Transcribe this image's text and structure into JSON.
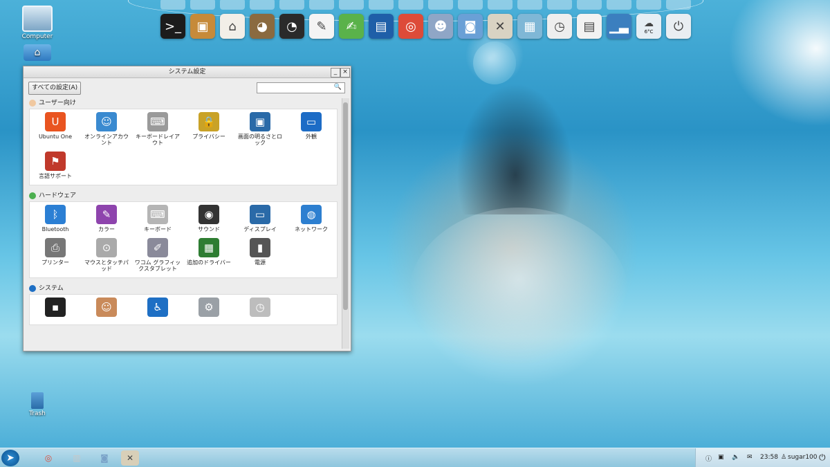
{
  "desktop": {
    "computer_label": "Computer",
    "trash_label": "Trash"
  },
  "window": {
    "title": "システム設定",
    "all_settings_button": "すべての設定(A)",
    "search_placeholder": "",
    "minimize_glyph": "_",
    "close_glyph": "×",
    "sections": [
      {
        "heading": "ユーザー向け",
        "items": [
          {
            "label": "Ubuntu One",
            "icon": "ubuntu-one-icon",
            "color": "#e95420",
            "glyph": "U"
          },
          {
            "label": "オンラインアカウント",
            "icon": "online-accounts-icon",
            "color": "#3a8ad0",
            "glyph": "☺"
          },
          {
            "label": "キーボードレイアウト",
            "icon": "keyboard-layout-icon",
            "color": "#9a9a9a",
            "glyph": "⌨"
          },
          {
            "label": "プライバシー",
            "icon": "privacy-lock-icon",
            "color": "#c9a227",
            "glyph": "🔒"
          },
          {
            "label": "画面の明るさとロック",
            "icon": "brightness-lock-icon",
            "color": "#2a6aa8",
            "glyph": "▣"
          },
          {
            "label": "外観",
            "icon": "appearance-icon",
            "color": "#1d6cc6",
            "glyph": "▭"
          },
          {
            "label": "言語サポート",
            "icon": "language-support-icon",
            "color": "#c0392b",
            "glyph": "⚑"
          }
        ]
      },
      {
        "heading": "ハードウェア",
        "items": [
          {
            "label": "Bluetooth",
            "icon": "bluetooth-icon",
            "color": "#2b7fd4",
            "glyph": "ᛒ"
          },
          {
            "label": "カラー",
            "icon": "color-icon",
            "color": "#8e44ad",
            "glyph": "✎"
          },
          {
            "label": "キーボード",
            "icon": "keyboard-icon",
            "color": "#b5b5b5",
            "glyph": "⌨"
          },
          {
            "label": "サウンド",
            "icon": "sound-icon",
            "color": "#333333",
            "glyph": "◉"
          },
          {
            "label": "ディスプレイ",
            "icon": "display-icon",
            "color": "#2a6aa8",
            "glyph": "▭"
          },
          {
            "label": "ネットワーク",
            "icon": "network-icon",
            "color": "#2d7fd0",
            "glyph": "◍"
          },
          {
            "label": "プリンター",
            "icon": "printer-icon",
            "color": "#777777",
            "glyph": "⎙"
          },
          {
            "label": "マウスとタッチパッド",
            "icon": "mouse-icon",
            "color": "#aaaaaa",
            "glyph": "⊙"
          },
          {
            "label": "ワコム グラフィックスタブレット",
            "icon": "wacom-tablet-icon",
            "color": "#8a8a9a",
            "glyph": "✐"
          },
          {
            "label": "追加のドライバー",
            "icon": "additional-drivers-icon",
            "color": "#2e7d32",
            "glyph": "▦"
          },
          {
            "label": "電源",
            "icon": "power-battery-icon",
            "color": "#555555",
            "glyph": "▮"
          }
        ]
      },
      {
        "heading": "システム",
        "items": [
          {
            "label": "",
            "icon": "backup-safe-icon",
            "color": "#222222",
            "glyph": "▪"
          },
          {
            "label": "",
            "icon": "user-accounts-icon",
            "color": "#c98a5a",
            "glyph": "☺"
          },
          {
            "label": "",
            "icon": "universal-access-icon",
            "color": "#1e6fc4",
            "glyph": "♿"
          },
          {
            "label": "",
            "icon": "details-gear-icon",
            "color": "#9aa0a6",
            "glyph": "⚙"
          },
          {
            "label": "",
            "icon": "time-date-icon",
            "color": "#bdbdbd",
            "glyph": "◷"
          }
        ]
      }
    ]
  },
  "dock": {
    "items": [
      {
        "icon": "terminal-icon",
        "color": "#1c1c1c",
        "glyph": ">_"
      },
      {
        "icon": "package-installer-icon",
        "color": "#c68a3a",
        "glyph": "▣"
      },
      {
        "icon": "home-folder-icon",
        "color": "#f2efe8",
        "glyph": "⌂"
      },
      {
        "icon": "gimp-icon",
        "color": "#8a6a40",
        "glyph": "◕"
      },
      {
        "icon": "mixxx-dj-icon",
        "color": "#2a2a2a",
        "glyph": "◔"
      },
      {
        "icon": "text-editor-icon",
        "color": "#f4f4f4",
        "glyph": "✎"
      },
      {
        "icon": "notes-leaf-icon",
        "color": "#5ab24a",
        "glyph": "✍"
      },
      {
        "icon": "ebook-reader-icon",
        "color": "#1f5fa8",
        "glyph": "▤"
      },
      {
        "icon": "chrome-icon",
        "color": "#dd4b39",
        "glyph": "◎"
      },
      {
        "icon": "photo-stamp-icon",
        "color": "#8fa6c6",
        "glyph": "☻"
      },
      {
        "icon": "screenshot-camera-icon",
        "color": "#6aa0d6",
        "glyph": "◙"
      },
      {
        "icon": "system-tools-icon",
        "color": "#d9d3c3",
        "glyph": "✕"
      },
      {
        "icon": "workspace-switcher-icon",
        "color": "#7fb7d6",
        "glyph": "▦"
      },
      {
        "icon": "clock-magnifier-icon",
        "color": "#eeeeee",
        "glyph": "◷"
      },
      {
        "icon": "system-monitor-icon",
        "color": "#f2f2f2",
        "glyph": "▤"
      },
      {
        "icon": "cpu-graph-icon",
        "color": "#3b7fbf",
        "glyph": "▁▃"
      },
      {
        "icon": "weather-cloud-icon",
        "color": "#e6eef4",
        "glyph": "☁",
        "text": "6°C"
      },
      {
        "icon": "power-logout-icon",
        "color": "#e9eef2",
        "glyph": "⏻"
      }
    ]
  },
  "taskbar": {
    "apps": [
      {
        "icon": "chrome-taskbar-icon",
        "color": "#dd4b39",
        "glyph": "◎"
      },
      {
        "icon": "files-taskbar-icon",
        "color": "#c7c7c7",
        "glyph": "▥"
      },
      {
        "icon": "camera-taskbar-icon",
        "color": "#7aa2c8",
        "glyph": "◙"
      },
      {
        "icon": "tools-taskbar-icon",
        "color": "#d8cfb8",
        "glyph": "✕"
      }
    ],
    "clock": "23:58",
    "user": "sugar100"
  }
}
